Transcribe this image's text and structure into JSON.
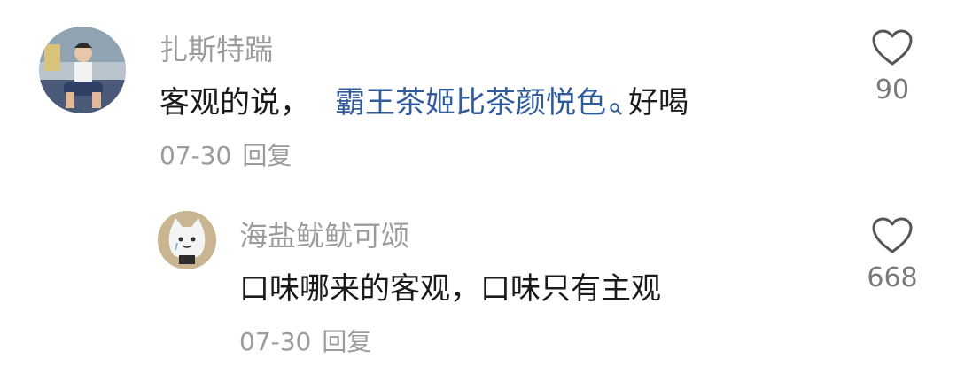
{
  "comments": [
    {
      "username": "扎斯特踹",
      "text_prefix": "客观的说，",
      "link_text": "霸王茶姬比茶颜悦色",
      "text_suffix": "好喝",
      "date": "07-30",
      "reply_label": "回复",
      "likes": "90"
    },
    {
      "username": "海盐鱿鱿可颂",
      "text": "口味哪来的客观，口味只有主观",
      "date": "07-30",
      "reply_label": "回复",
      "likes": "668"
    }
  ],
  "colors": {
    "username": "#9b9b9b",
    "text": "#1a1a1a",
    "link": "#2f5b9b",
    "meta": "#9b9b9b"
  },
  "icons": {
    "like": "heart-outline-icon",
    "search_hint": "search-icon"
  }
}
